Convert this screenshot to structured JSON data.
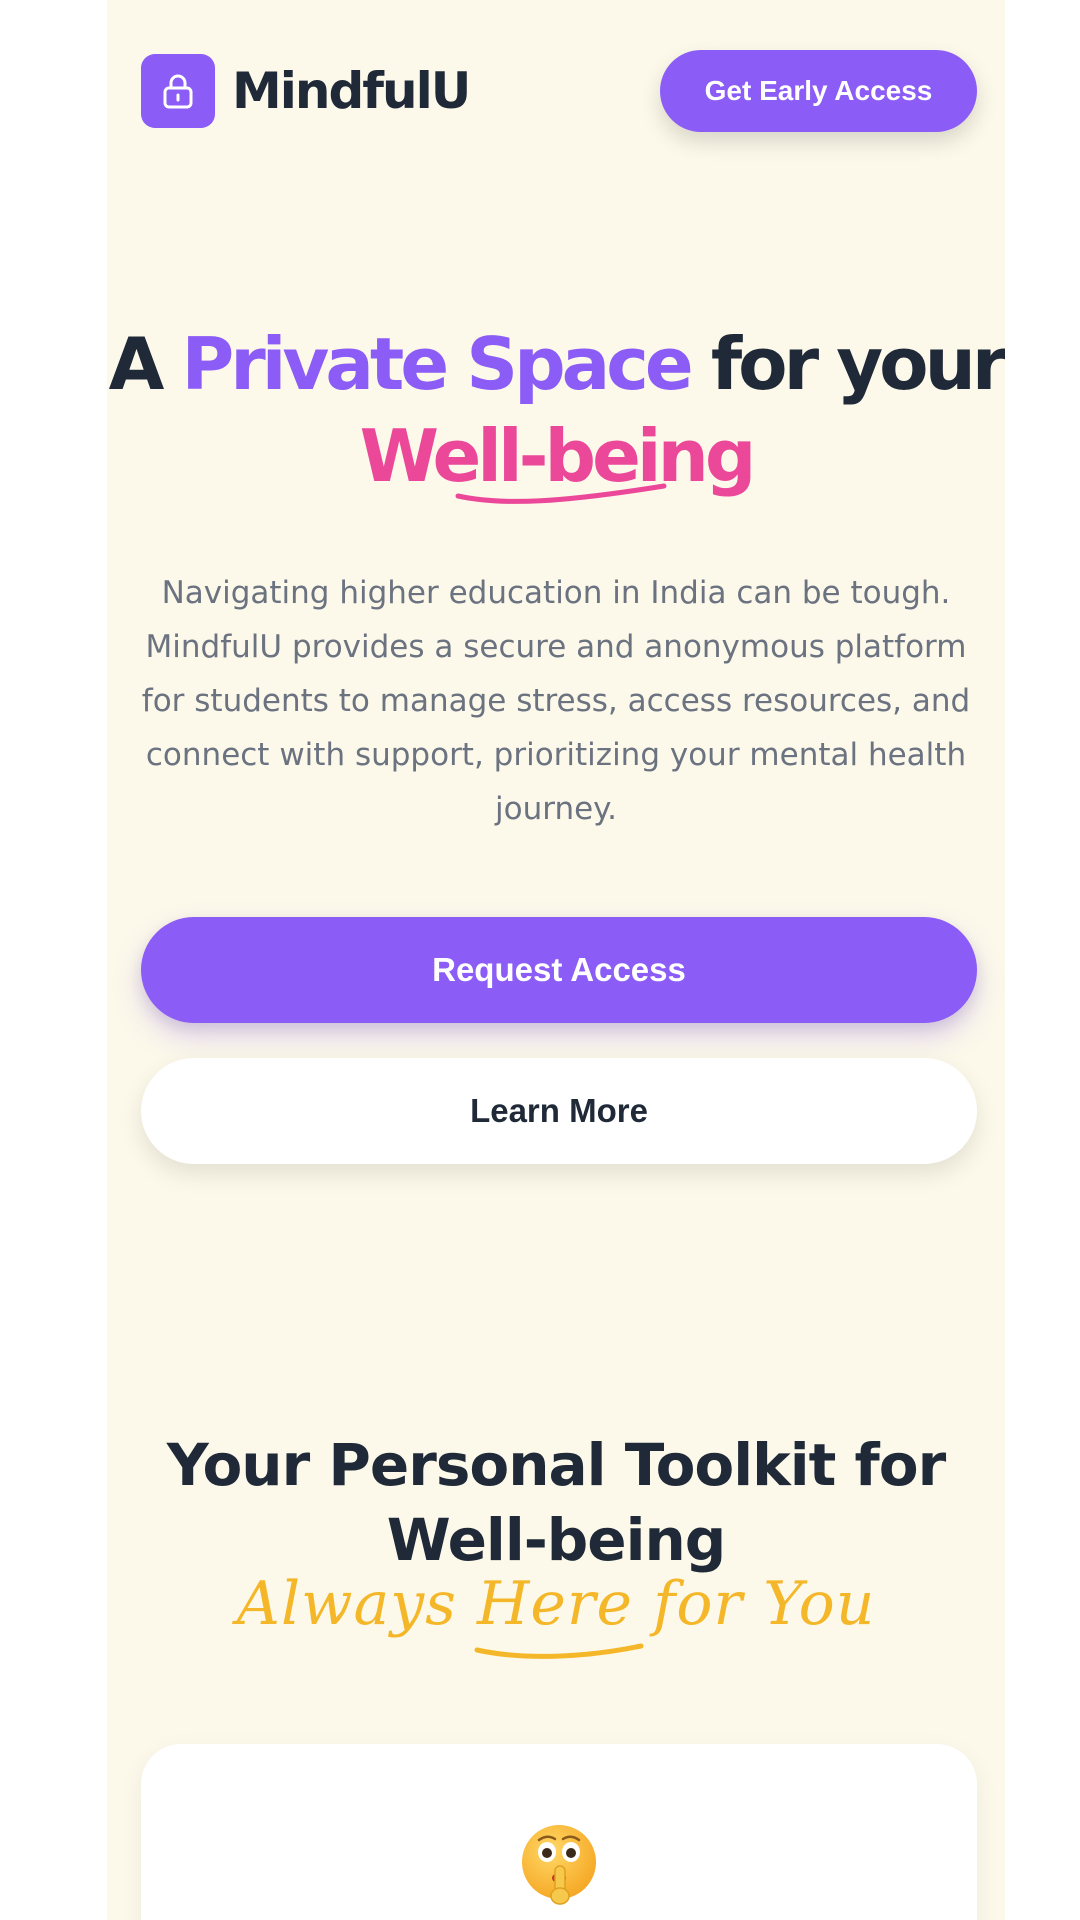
{
  "header": {
    "brand": "MindfulU",
    "logo_icon": "lock-icon",
    "cta_label": "Get Early Access"
  },
  "hero": {
    "title_part1": "A",
    "title_highlight1": "Private Space",
    "title_part2": "for your",
    "title_highlight2": "Well-being",
    "subtitle": "Navigating higher education in India can be tough. MindfulU provides a secure and anonymous platform for students to manage stress, access resources, and connect with support, prioritizing your mental health journey.",
    "primary_button": "Request Access",
    "secondary_button": "Learn More"
  },
  "features": {
    "title": "Your Personal Toolkit for Well-being",
    "tagline": "Always Here for You",
    "cards": [
      {
        "icon": "shushing-face-icon"
      }
    ]
  },
  "colors": {
    "background": "#fcf9ea",
    "brand_purple": "#8b5cf6",
    "accent_pink": "#ec4899",
    "accent_yellow": "#f5b72a",
    "heading": "#1f2937",
    "body_text": "#6b7280"
  }
}
